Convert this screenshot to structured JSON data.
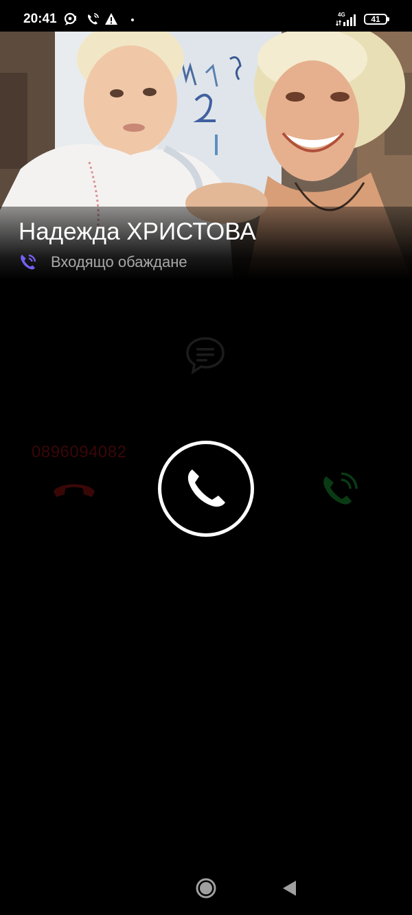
{
  "status_bar": {
    "time": "20:41",
    "network": "4G",
    "battery": "41",
    "icons": [
      "chat-bubble-icon",
      "wifi-call-icon",
      "warning-icon",
      "notification-dot-icon",
      "signal-icon",
      "battery-icon"
    ]
  },
  "caller": {
    "name": "Надежда ХРИСТОВА",
    "status": "Входящо обаждане",
    "number": "0896094082"
  },
  "controls": {
    "message_icon": "message-icon",
    "decline_icon": "decline-call-icon",
    "answer_icon": "answer-call-icon",
    "video_icon": "phone-ring-icon"
  },
  "colors": {
    "accent": "#7360f2",
    "decline": "#3a0707",
    "accept": "#0a3a14",
    "background": "#000000"
  },
  "navigation": {
    "home": "home-button",
    "back": "back-button"
  }
}
